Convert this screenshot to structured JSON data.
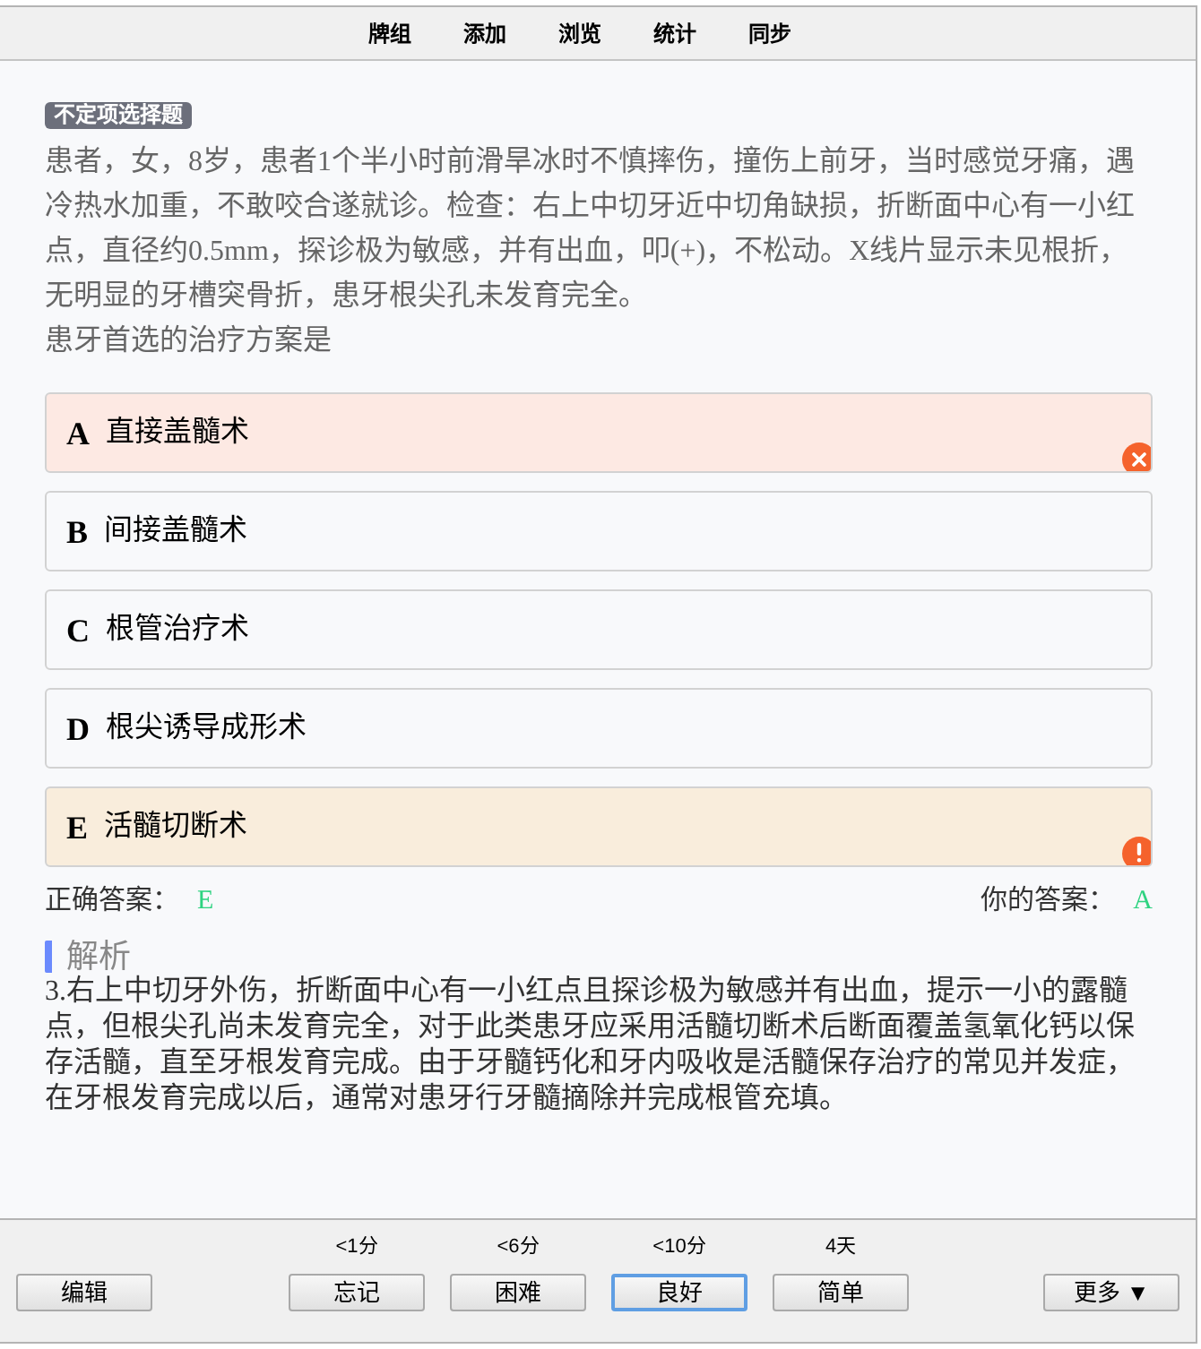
{
  "menu": [
    {
      "label": "牌组"
    },
    {
      "label": "添加"
    },
    {
      "label": "浏览"
    },
    {
      "label": "统计"
    },
    {
      "label": "同步"
    }
  ],
  "question": {
    "type_badge": "不定项选择题",
    "stem": [
      "患者，女，8岁，患者1个半小时前滑旱冰时不慎摔伤，撞伤上前牙，当时感觉牙痛，遇冷热水加重，不敢咬合遂就诊。检查：右上中切牙近中切角缺损，折断面中心有一小红点，直径约0.5mm，探诊极为敏感，并有出血，叩(+)，不松动。X线片显示未见根折，无明显的牙槽突骨折，患牙根尖孔未发育完全。",
      "患牙首选的治疗方案是"
    ]
  },
  "options": [
    {
      "letter": "A",
      "text": "直接盖髓术",
      "kind": "wrong"
    },
    {
      "letter": "B",
      "text": "间接盖髓术",
      "kind": "plain"
    },
    {
      "letter": "C",
      "text": "根管治疗术",
      "kind": "plain"
    },
    {
      "letter": "D",
      "text": "根尖诱导成形术",
      "kind": "plain"
    },
    {
      "letter": "E",
      "text": "活髓切断术",
      "kind": "missed"
    }
  ],
  "answers": {
    "correct_label": "正确答案：",
    "correct_value": "E",
    "yours_label": "你的答案：",
    "yours_value": "A"
  },
  "explanation": {
    "heading": "解析",
    "text": "3.右上中切牙外伤，折断面中心有一小红点且探诊极为敏感并有出血，提示一小的露髓点，但根尖孔尚未发育完全，对于此类患牙应采用活髓切断术后断面覆盖氢氧化钙以保存活髓，直至牙根发育完成。由于牙髓钙化和牙内吸收是活髓保存治疗的常见并发症，在牙根发育完成以后，通常对患牙行牙髓摘除并完成根管充填。"
  },
  "bottom_bar": {
    "edit_button": "编辑",
    "ease_buttons": [
      {
        "interval": "<1分",
        "label": "忘记",
        "selected": false
      },
      {
        "interval": "<6分",
        "label": "困难",
        "selected": false
      },
      {
        "interval": "<10分",
        "label": "良好",
        "selected": true
      },
      {
        "interval": "4天",
        "label": "简单",
        "selected": false
      }
    ],
    "more_button": "更多 ▼"
  }
}
